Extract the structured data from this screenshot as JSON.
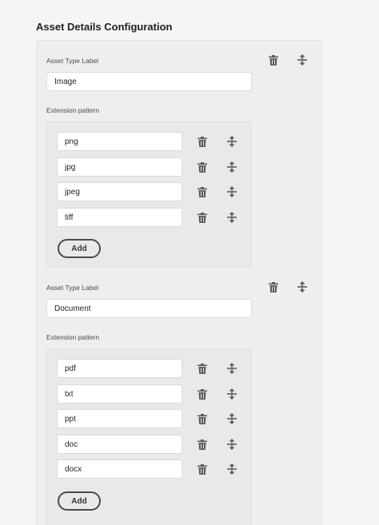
{
  "page": {
    "title": "Asset Details Configuration"
  },
  "asset_types": [
    {
      "type_label_caption": "Asset Type Label",
      "type_value": "Image",
      "extension_caption": "Extension pattern",
      "extensions": [
        "png",
        "jpg",
        "jpeg",
        "tiff"
      ],
      "add_label": "Add"
    },
    {
      "type_label_caption": "Asset Type Label",
      "type_value": "Document",
      "extension_caption": "Extension pattern",
      "extensions": [
        "pdf",
        "txt",
        "ppt",
        "doc",
        "docx"
      ],
      "add_label": "Add"
    }
  ],
  "icons": {
    "delete": "trash-icon",
    "reorder": "drag-handle-icon"
  },
  "colors": {
    "icon": "#5a5a5a",
    "panel": "#eeeeee",
    "inner_panel": "#e9e9e9"
  }
}
